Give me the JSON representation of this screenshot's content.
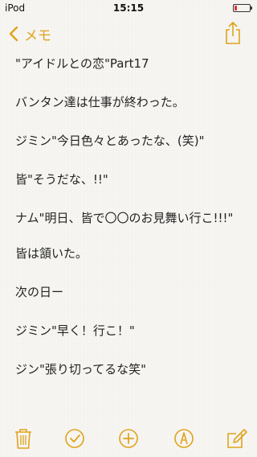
{
  "status_bar": {
    "device": "iPod",
    "time": "15:15",
    "battery_level": 0.15,
    "battery_color": "#e0312e"
  },
  "nav": {
    "back_label": "メモ",
    "accent": "#e0a31c"
  },
  "note": {
    "lines": [
      "\"アイドルとの恋\"Part17",
      "バンタン達は仕事が終わった。",
      "ジミン\"今日色々とあったな、(笑)\"",
      "皆\"そうだな、!!\"",
      "ナム\"明日、皆で〇〇のお見舞い行こ!!!\"",
      "皆は頷いた。",
      "次の日ー",
      "ジミン\"早く！行こ！\"",
      "ジン\"張り切ってるな笑\""
    ]
  },
  "toolbar": {
    "icons": [
      "trash-icon",
      "checklist-icon",
      "add-icon",
      "sketch-icon",
      "compose-icon"
    ]
  }
}
